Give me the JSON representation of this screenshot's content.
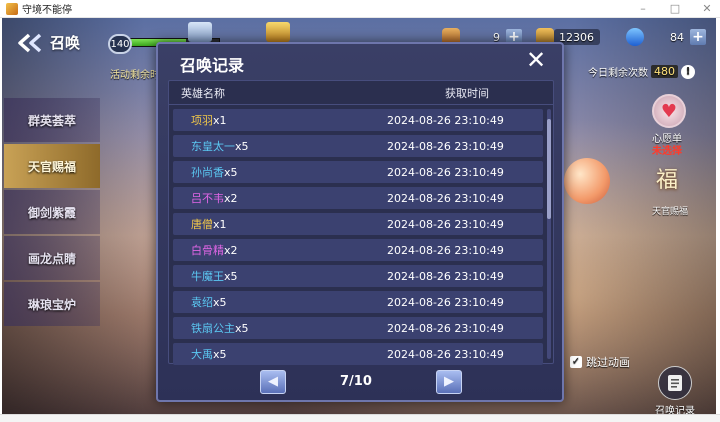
{
  "window": {
    "title": "守境不能停"
  },
  "header": {
    "back_label": "召唤",
    "level": "140",
    "exp_progress": 0.62,
    "activity_text": "活动剩余时"
  },
  "resources": [
    {
      "icon": "scroll-icon",
      "value": "9"
    },
    {
      "icon": "gold-coin-icon",
      "value": "12306"
    },
    {
      "icon": "diamond-icon",
      "value": "84"
    }
  ],
  "remaining": {
    "label": "今日剩余次数",
    "count": "480"
  },
  "side_menu": [
    {
      "label": "群英荟萃",
      "active": false
    },
    {
      "label": "天官赐福",
      "active": true
    },
    {
      "label": "御剑紫霞",
      "active": false
    },
    {
      "label": "画龙点睛",
      "active": false
    },
    {
      "label": "琳琅宝炉",
      "active": false
    }
  ],
  "right_panel": {
    "wish_label": "心愿单",
    "wish_status": "未选择",
    "blessing_glyph": "福",
    "blessing_label": "天官赐福",
    "skip_anim_label": "跳过动画",
    "record_label": "召唤记录"
  },
  "modal": {
    "title": "召唤记录",
    "col_name": "英雄名称",
    "col_time": "获取时间",
    "rows": [
      {
        "hero": "项羽",
        "count": "x1",
        "time": "2024-08-26 23:10:49",
        "color": "#f0c74a"
      },
      {
        "hero": "东皇太一",
        "count": "x5",
        "time": "2024-08-26 23:10:49",
        "color": "#5bc8f2"
      },
      {
        "hero": "孙尚香",
        "count": "x5",
        "time": "2024-08-26 23:10:49",
        "color": "#5bc8f2"
      },
      {
        "hero": "吕不韦",
        "count": "x2",
        "time": "2024-08-26 23:10:49",
        "color": "#e066e6"
      },
      {
        "hero": "唐僧",
        "count": "x1",
        "time": "2024-08-26 23:10:49",
        "color": "#f0c74a"
      },
      {
        "hero": "白骨精",
        "count": "x2",
        "time": "2024-08-26 23:10:49",
        "color": "#e066e6"
      },
      {
        "hero": "牛魔王",
        "count": "x5",
        "time": "2024-08-26 23:10:49",
        "color": "#5bc8f2"
      },
      {
        "hero": "袁绍",
        "count": "x5",
        "time": "2024-08-26 23:10:49",
        "color": "#5bc8f2"
      },
      {
        "hero": "铁扇公主",
        "count": "x5",
        "time": "2024-08-26 23:10:49",
        "color": "#5bc8f2"
      },
      {
        "hero": "大禹",
        "count": "x5",
        "time": "2024-08-26 23:10:49",
        "color": "#5bc8f2"
      }
    ],
    "page": "7/10"
  }
}
